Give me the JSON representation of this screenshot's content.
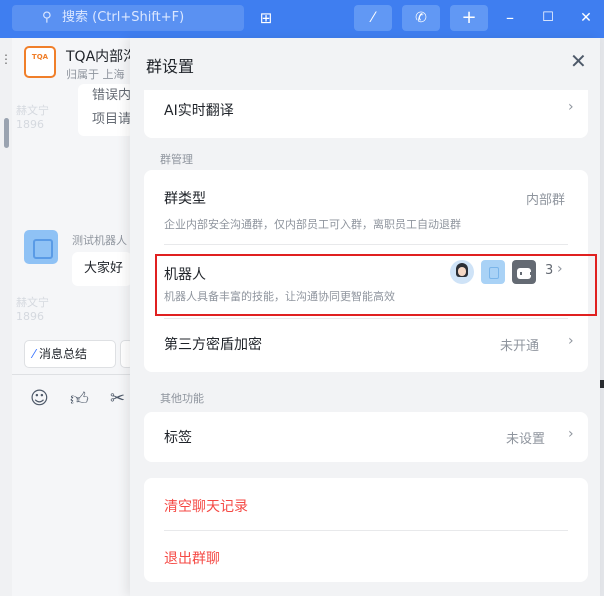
{
  "topbar": {
    "search_placeholder": "搜索 (Ctrl+Shift+F)",
    "search_icon": "search-icon",
    "apps_icon": "grid-plus-icon",
    "magic_icon": "magic-wand-icon",
    "call_icon": "phone-call-icon",
    "add_icon": "plus-icon",
    "minimize": "–",
    "maximize": "☐",
    "close": "✕"
  },
  "chat": {
    "group_logo_text": "TQA",
    "group_name": "TQA内部沟",
    "group_sub": "归属于 上海",
    "bubble1_text": "错误内",
    "bubble2_text": "项目请",
    "watermark_name": "赫文宁",
    "watermark_id": "1896",
    "bot_name": "测试机器人",
    "hello_text": "大家好",
    "summary_button": "消息总结"
  },
  "panel": {
    "title": "群设置",
    "ai_translate": "AI实时翻译",
    "section_group_manage": "群管理",
    "group_type_label": "群类型",
    "group_type_value": "内部群",
    "group_type_desc": "企业内部安全沟通群，仅内部员工可入群，离职员工自动退群",
    "robot_label": "机器人",
    "robot_desc": "机器人具备丰富的技能，让沟通协同更智能高效",
    "robot_count": "3",
    "third_party_label": "第三方密盾加密",
    "third_party_value": "未开通",
    "section_other": "其他功能",
    "tag_label": "标签",
    "tag_value": "未设置",
    "clear_history": "清空聊天记录",
    "leave_group": "退出群聊"
  },
  "colors": {
    "brand_blue": "#3f7ef0",
    "danger_red": "#f54a45",
    "highlight_border": "#e02020"
  }
}
